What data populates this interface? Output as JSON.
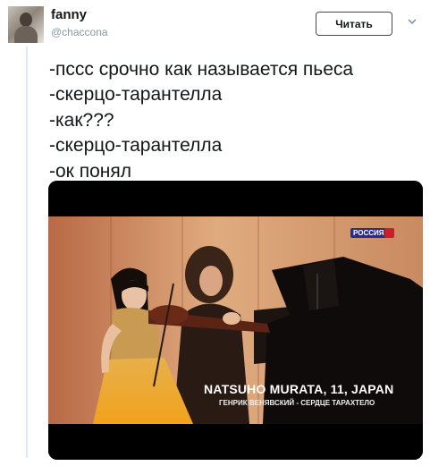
{
  "tweet": {
    "display_name": "fanny",
    "handle": "@chaccona",
    "follow_label": "Читать",
    "text_lines": [
      "-пссс срочно как называется пьеса",
      "-скерцо-тарантелла",
      "-как???",
      "-скерцо-тарантелла",
      "-ок понял"
    ]
  },
  "media": {
    "channel_logo": "РОССИЯ",
    "caption_name": "NATSUHO MURATA, 11, JAPAN",
    "caption_piece": "ГЕНРИК ВЕНЯВСКИЙ - СЕРДЦЕ ТАРАХТЕЛО"
  },
  "icons": {
    "more": "chevron-down-icon",
    "avatar": "avatar"
  },
  "colors": {
    "name": "#14171a",
    "handle": "#8899a6",
    "thread_line": "#e1e8ed",
    "stage": "#d9a37a"
  }
}
